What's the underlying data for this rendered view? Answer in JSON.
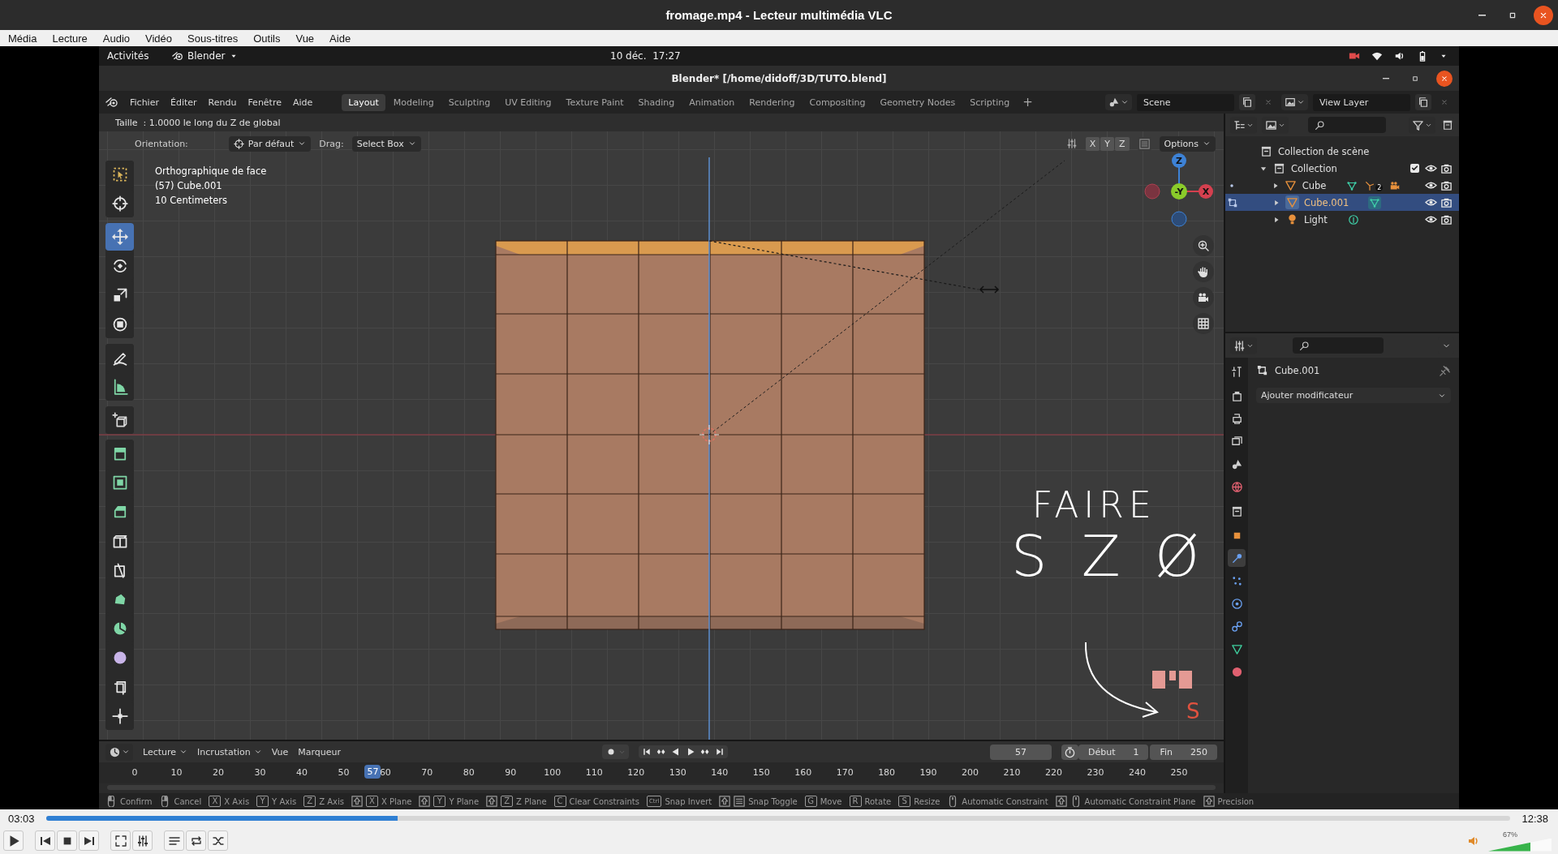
{
  "window": {
    "title": "fromage.mp4 - Lecteur multimédia VLC"
  },
  "menu": [
    "Média",
    "Lecture",
    "Audio",
    "Vidéo",
    "Sous-titres",
    "Outils",
    "Vue",
    "Aide"
  ],
  "recording": {
    "desktop_bar": {
      "activities": "Activités",
      "app": "Blender",
      "clock": "10 déc.  17:27"
    },
    "blender": {
      "title": "Blender* [/home/didoff/3D/TUTO.blend]",
      "menus": [
        "Fichier",
        "Éditer",
        "Rendu",
        "Fenêtre",
        "Aide"
      ],
      "workspaces": [
        {
          "label": "Layout",
          "selected": true
        },
        {
          "label": "Modeling",
          "selected": false
        },
        {
          "label": "Sculpting",
          "selected": false
        },
        {
          "label": "UV Editing",
          "selected": false
        },
        {
          "label": "Texture Paint",
          "selected": false
        },
        {
          "label": "Shading",
          "selected": false
        },
        {
          "label": "Animation",
          "selected": false
        },
        {
          "label": "Rendering",
          "selected": false
        },
        {
          "label": "Compositing",
          "selected": false
        },
        {
          "label": "Geometry Nodes",
          "selected": false
        },
        {
          "label": "Scripting",
          "selected": false
        }
      ],
      "add_workspace": "+",
      "scene": "Scene",
      "view_layer": "View Layer",
      "viewport": {
        "operator_info": "Taille  : 1.0000 le long du Z de global",
        "orientation_label": "Orientation:",
        "orientation": "Par défaut",
        "drag_label": "Drag:",
        "drag": "Select Box",
        "axes": [
          {
            "label": "X",
            "selected": false
          },
          {
            "label": "Y",
            "selected": false
          },
          {
            "label": "Z",
            "selected": false
          }
        ],
        "options": "Options",
        "overlay": [
          "Orthographique de face",
          "(57) Cube.001",
          "10 Centimeters"
        ],
        "tool_groups": [
          [
            {
              "kind": "select-box",
              "selected": false
            },
            {
              "kind": "cursor",
              "selected": false
            }
          ],
          [
            {
              "kind": "move",
              "selected": true
            },
            {
              "kind": "rotate",
              "selected": false
            },
            {
              "kind": "scale",
              "selected": false
            },
            {
              "kind": "transform",
              "selected": false
            }
          ],
          [
            {
              "kind": "pencil",
              "selected": false
            },
            {
              "kind": "ruler",
              "selected": false
            }
          ],
          [
            {
              "kind": "add-cube",
              "selected": false
            }
          ],
          [
            {
              "kind": "extrude",
              "selected": false
            },
            {
              "kind": "inset",
              "selected": false
            },
            {
              "kind": "bevel",
              "selected": false
            },
            {
              "kind": "loop-cut",
              "selected": false
            },
            {
              "kind": "knife",
              "selected": false
            },
            {
              "kind": "poly-build",
              "selected": false
            },
            {
              "kind": "spin",
              "selected": false
            },
            {
              "kind": "sphere",
              "selected": false
            },
            {
              "kind": "shear",
              "selected": false
            },
            {
              "kind": "push-pull",
              "selected": false
            }
          ]
        ],
        "gizmo": {
          "z": "Z",
          "y": "-Y",
          "x": "X"
        },
        "annotation": {
          "lines": [
            "FAIRE",
            "S Z Ø"
          ],
          "key": "S"
        }
      },
      "timeline": {
        "menus": [
          {
            "label": "Lecture",
            "dropdown": true
          },
          {
            "label": "Incrustation",
            "dropdown": true
          },
          {
            "label": "Vue",
            "dropdown": false
          },
          {
            "label": "Marqueur",
            "dropdown": false
          }
        ],
        "frame": "57",
        "start_label": "Début",
        "start": "1",
        "end_label": "Fin",
        "end": "250",
        "ticks": [
          "0",
          "10",
          "20",
          "30",
          "40",
          "50",
          "60",
          "70",
          "80",
          "90",
          "100",
          "110",
          "120",
          "130",
          "140",
          "150",
          "160",
          "170",
          "180",
          "190",
          "200",
          "210",
          "220",
          "230",
          "240",
          "250"
        ],
        "playhead": {
          "label": "57",
          "level": 0.228
        }
      },
      "status": [
        {
          "keys": [
            {
              "kind": "mouse-left"
            }
          ],
          "label": "Confirm"
        },
        {
          "keys": [
            {
              "kind": "mouse-right"
            }
          ],
          "label": "Cancel"
        },
        {
          "keys": [
            {
              "kind": "letter",
              "text": "X"
            }
          ],
          "label": "X Axis"
        },
        {
          "keys": [
            {
              "kind": "letter",
              "text": "Y"
            }
          ],
          "label": "Y Axis"
        },
        {
          "keys": [
            {
              "kind": "letter",
              "text": "Z"
            }
          ],
          "label": "Z Axis"
        },
        {
          "keys": [
            {
              "kind": "shift"
            },
            {
              "kind": "letter",
              "text": "X"
            }
          ],
          "label": "X Plane"
        },
        {
          "keys": [
            {
              "kind": "shift"
            },
            {
              "kind": "letter",
              "text": "Y"
            }
          ],
          "label": "Y Plane"
        },
        {
          "keys": [
            {
              "kind": "shift"
            },
            {
              "kind": "letter",
              "text": "Z"
            }
          ],
          "label": "Z Plane"
        },
        {
          "keys": [
            {
              "kind": "letter",
              "text": "C"
            }
          ],
          "label": "Clear Constraints"
        },
        {
          "keys": [
            {
              "kind": "letter",
              "text": "Ctrl"
            }
          ],
          "label": "Snap Invert"
        },
        {
          "keys": [
            {
              "kind": "shift"
            },
            {
              "kind": "snap"
            }
          ],
          "label": "Snap Toggle"
        },
        {
          "keys": [
            {
              "kind": "letter",
              "text": "G"
            }
          ],
          "label": "Move"
        },
        {
          "keys": [
            {
              "kind": "letter",
              "text": "R"
            }
          ],
          "label": "Rotate"
        },
        {
          "keys": [
            {
              "kind": "letter",
              "text": "S"
            }
          ],
          "label": "Resize"
        },
        {
          "keys": [
            {
              "kind": "mouse-middle"
            }
          ],
          "label": "Automatic Constraint"
        },
        {
          "keys": [
            {
              "kind": "shift"
            },
            {
              "kind": "mouse-middle"
            }
          ],
          "label": "Automatic Constraint Plane"
        },
        {
          "keys": [
            {
              "kind": "shift"
            }
          ],
          "label": "Precision"
        }
      ],
      "outliner": {
        "tree": [
          {
            "label": "Collection de scène",
            "kind": "scene-collection",
            "children": [
              {
                "label": "Collection",
                "kind": "collection",
                "expanded": true,
                "checked": true,
                "children": [
                  {
                    "label": "Cube",
                    "kind": "mesh",
                    "expanded": false,
                    "selected": false,
                    "edit_mode": false,
                    "badges": [
                      {
                        "kind": "mesh-data"
                      },
                      {
                        "kind": "fork",
                        "count": "2"
                      },
                      {
                        "kind": "movie-camera"
                      }
                    ]
                  },
                  {
                    "label": "Cube.001",
                    "kind": "mesh",
                    "expanded": false,
                    "selected": true,
                    "edit_mode": true,
                    "badges": [
                      {
                        "kind": "mesh-data"
                      }
                    ]
                  },
                  {
                    "label": "Light",
                    "kind": "light",
                    "expanded": false,
                    "selected": false,
                    "edit_mode": false,
                    "badges": [
                      {
                        "kind": "light-data"
                      }
                    ]
                  }
                ]
              }
            ]
          }
        ]
      },
      "properties": {
        "object": "Cube.001",
        "add_modifier": "Ajouter modificateur",
        "tab_groups": [
          [
            {
              "kind": "tool",
              "selected": false
            }
          ],
          [
            {
              "kind": "render",
              "selected": false
            },
            {
              "kind": "output",
              "selected": false
            },
            {
              "kind": "view-layer",
              "selected": false
            },
            {
              "kind": "scene",
              "selected": false
            },
            {
              "kind": "world",
              "selected": false
            }
          ],
          [
            {
              "kind": "collection",
              "selected": false
            }
          ],
          [
            {
              "kind": "object",
              "selected": false
            },
            {
              "kind": "modifiers",
              "selected": true
            },
            {
              "kind": "particles",
              "selected": false
            },
            {
              "kind": "physics",
              "selected": false
            },
            {
              "kind": "constraints",
              "selected": false
            },
            {
              "kind": "data",
              "selected": false
            },
            {
              "kind": "material",
              "selected": false
            }
          ]
        ]
      }
    }
  },
  "player": {
    "elapsed": "03:03",
    "progress": {
      "level": 0.24
    },
    "remaining": "12:38",
    "volume": {
      "reading": "67%",
      "level": 0.67
    }
  }
}
